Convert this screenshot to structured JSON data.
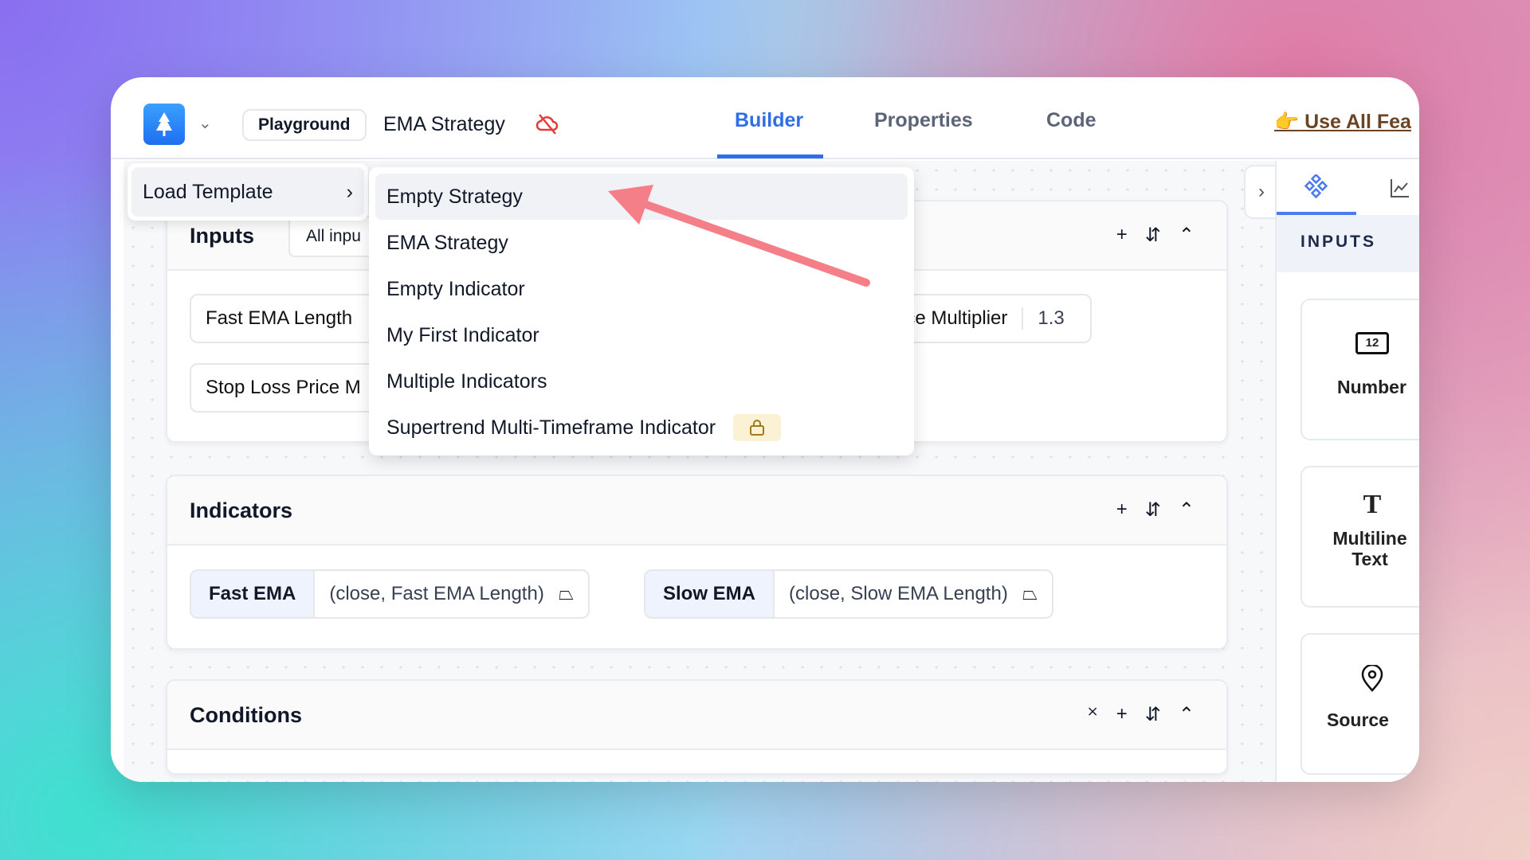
{
  "header": {
    "workspace": "Playground",
    "strategy_title": "EMA Strategy",
    "tabs": [
      {
        "label": "Builder",
        "active": true
      },
      {
        "label": "Properties"
      },
      {
        "label": "Code"
      }
    ],
    "promo_link": "Use All Fea",
    "promo_emoji": "👉",
    "accent": "#2f6ee6"
  },
  "menu": {
    "load_template": "Load Template",
    "templates": [
      "Empty Strategy",
      "EMA Strategy",
      "Empty Indicator",
      "My First Indicator",
      "Multiple Indicators",
      "Supertrend Multi-Timeframe Indicator"
    ],
    "highlighted": "Empty Strategy",
    "locked": "Supertrend Multi-Timeframe Indicator"
  },
  "inputs": {
    "title": "Inputs",
    "filter": "All inpu",
    "chips": [
      {
        "label": "Fast EMA Length"
      },
      {
        "label": "Price Multiplier",
        "value": "1.3"
      },
      {
        "label": "Stop Loss Price M"
      }
    ]
  },
  "indicators": {
    "title": "Indicators",
    "chips": [
      {
        "name": "Fast EMA",
        "args": "(close, Fast EMA Length)"
      },
      {
        "name": "Slow EMA",
        "args": "(close, Slow EMA Length)"
      }
    ]
  },
  "conditions": {
    "title": "Conditions"
  },
  "right_panel": {
    "section": "INPUTS",
    "cards": [
      {
        "icon": "12",
        "label": "Number"
      },
      {
        "label": "Multiline Text"
      },
      {
        "label": "Source"
      }
    ]
  }
}
